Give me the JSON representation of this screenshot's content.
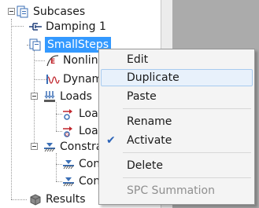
{
  "tree": {
    "root": {
      "label": "Subcases",
      "icon": "subcases-icon"
    },
    "items": [
      {
        "label": "Damping 1",
        "icon": "damping-icon"
      },
      {
        "label": "SmallSteps",
        "icon": "subcase-icon"
      },
      {
        "label": "Nonlin",
        "icon": "nonlinear-icon"
      },
      {
        "label": "Dynam",
        "icon": "dynamic-icon"
      },
      {
        "label": "Loads",
        "icon": "loads-icon"
      },
      {
        "label": "Loa",
        "icon": "load-icon"
      },
      {
        "label": "Loa",
        "icon": "load-icon"
      },
      {
        "label": "Constra",
        "icon": "constraints-icon"
      },
      {
        "label": "Con",
        "icon": "constraint-icon"
      },
      {
        "label": "Con",
        "icon": "constraint-icon"
      },
      {
        "label": "Results",
        "icon": "results-icon"
      }
    ]
  },
  "menu": {
    "items": [
      {
        "label": "Edit"
      },
      {
        "label": "Duplicate"
      },
      {
        "label": "Paste"
      },
      {
        "label": "Rename"
      },
      {
        "label": "Activate"
      },
      {
        "label": "Delete"
      },
      {
        "label": "SPC Summation"
      }
    ],
    "check_mark": "✔",
    "hover_color": "#e8f1fb",
    "disabled_color": "#8f8f8f"
  },
  "colors": {
    "selection": "#3399ff",
    "right_panel": "#ababab"
  }
}
